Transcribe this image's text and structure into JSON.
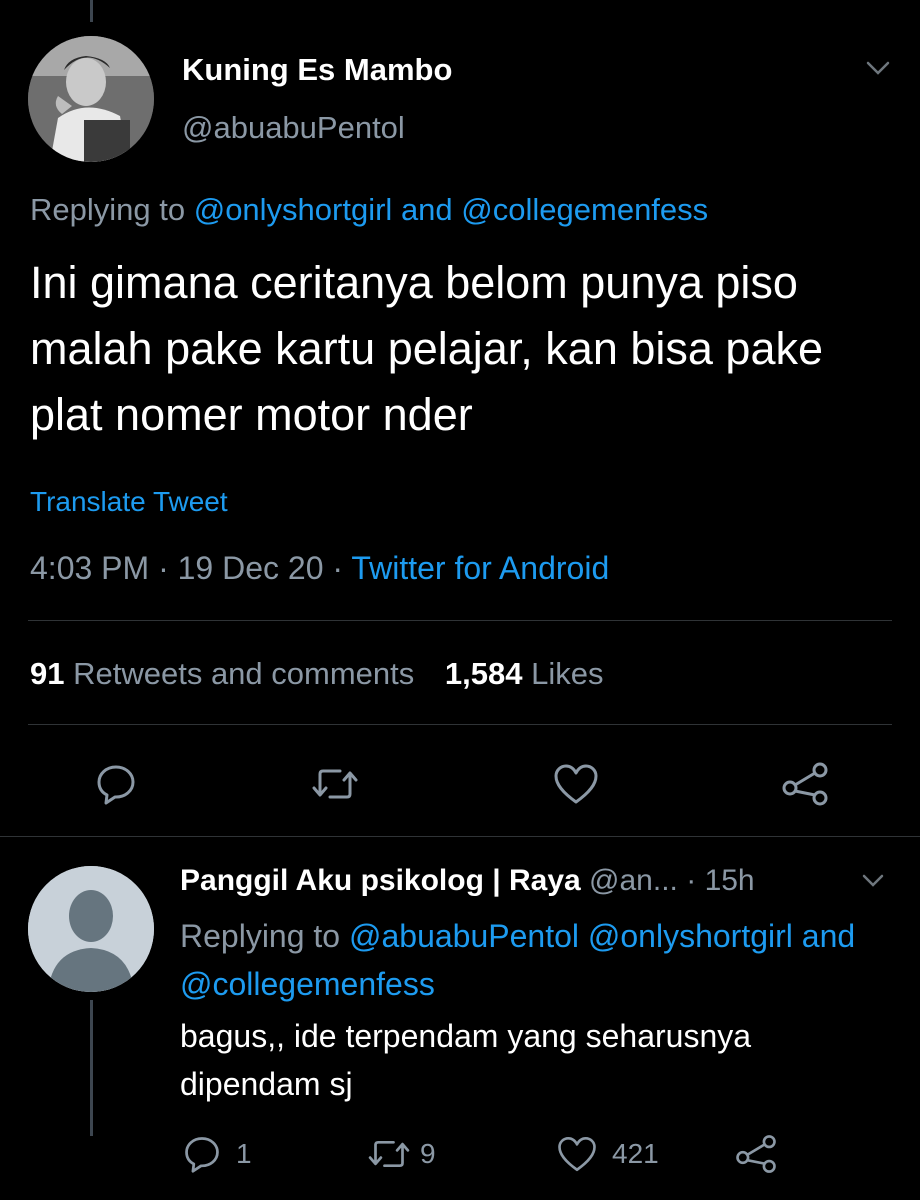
{
  "main_tweet": {
    "author_name": "Kuning Es Mambo",
    "author_handle": "@abuabuPentol",
    "replying_prefix": "Replying to",
    "replying_mention_1": "@onlyshortgirl",
    "replying_and": "and",
    "replying_mention_2": "@collegemenfess",
    "text": "Ini gimana ceritanya belom punya piso malah pake kartu pelajar, kan bisa pake plat nomer motor nder",
    "translate_label": "Translate Tweet",
    "time": "4:03 PM",
    "date": "19 Dec 20",
    "source": "Twitter for Android",
    "separator": "·",
    "retweets_count": "91",
    "retweets_label": "Retweets and comments",
    "likes_count": "1,584",
    "likes_label": "Likes"
  },
  "reply": {
    "author_name": "Panggil Aku psikolog | Raya",
    "author_handle": "@an...",
    "separator": "·",
    "time_ago": "15h",
    "replying_prefix": "Replying to",
    "replying_mention_1": "@abuabuPentol",
    "replying_mention_2": "@onlyshortgirl",
    "replying_and": "and",
    "replying_mention_3": "@collegemenfess",
    "text_line_1": "bagus,, ide terpendam yang seharusnya",
    "text_line_2": "dipendam sj",
    "comment_count": "1",
    "retweet_count": "9",
    "like_count": "421"
  },
  "colors": {
    "background": "#000000",
    "link": "#1d9bf0",
    "secondary_text": "#8b98a5",
    "divider": "#2f3336"
  },
  "icons": [
    "chevron-down-icon",
    "comment-icon",
    "retweet-icon",
    "heart-icon",
    "share-icon",
    "default-avatar-icon"
  ]
}
